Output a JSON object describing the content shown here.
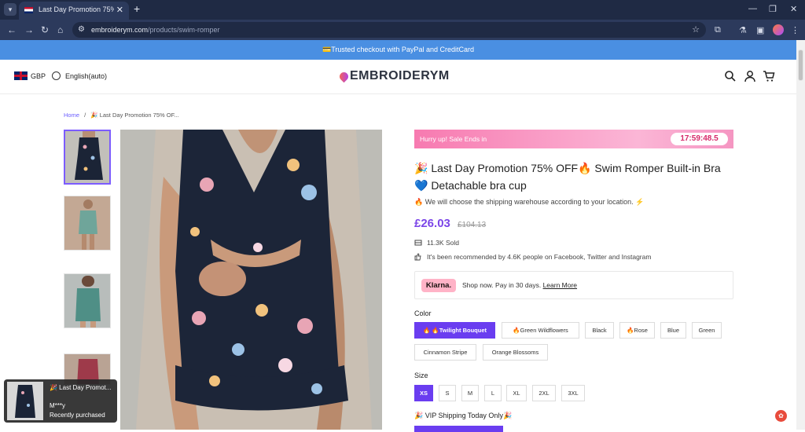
{
  "browser": {
    "tab_title": "Last Day Promotion 75% Of",
    "tab_close": "✕",
    "new_tab": "+",
    "url_domain": "embroiderym.com",
    "url_path": "/products/swim-romper",
    "window_controls": [
      "—",
      "❐",
      "✕"
    ]
  },
  "announcement": "💳Trusted checkout with PayPal and CreditCard",
  "header": {
    "currency": "GBP",
    "language": "English(auto)",
    "logo": "EMBROIDERYM"
  },
  "breadcrumb": {
    "home": "Home",
    "separator": "/",
    "current": "🎉 Last Day Promotion 75% OF..."
  },
  "product": {
    "sale_label": "Hurry up! Sale Ends in",
    "countdown": "17:59:48.5",
    "title": "🎉 Last Day Promotion 75% OFF🔥 Swim Romper Built-in Bra💙 Detachable bra cup",
    "shipping_note": "🔥 We will choose the shipping warehouse according to your location. ⚡",
    "price": "£26.03",
    "old_price": "£104.13",
    "sold": "11.3K Sold",
    "recommended": "It's been recommended by 4.6K people on Facebook, Twitter and Instagram",
    "klarna_badge": "Klarna.",
    "klarna_text": "Shop now. Pay in 30 days.",
    "klarna_link": "Learn More",
    "color_label": "Color",
    "colors": [
      "🔥 🔥Twilight Bouquet",
      "🔥Green Wildflowers",
      "Black",
      "🔥Rose",
      "Blue",
      "Green",
      "Cinnamon Stripe",
      "Orange Blossoms"
    ],
    "size_label": "Size",
    "sizes": [
      "XS",
      "S",
      "M",
      "L",
      "XL",
      "2XL",
      "3XL"
    ],
    "vip_shipping": "🎉 VIP Shipping Today Only🎉"
  },
  "toast": {
    "title": "🎉 Last Day Promot...",
    "buyer": "M***y",
    "status": "Recently purchased"
  },
  "colors": {
    "accent": "#6a3df0",
    "announce": "#4a8fe2",
    "price": "#7b45e8"
  }
}
